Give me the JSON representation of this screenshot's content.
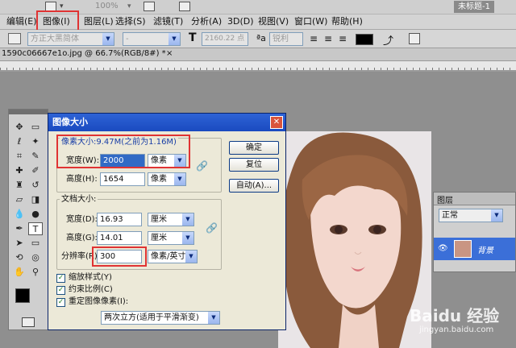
{
  "topbar": {
    "workspace_label": "未标题-1",
    "zoom": "100%"
  },
  "menubar": {
    "items": [
      "编辑(E)",
      "图像(I)",
      "图层(L)",
      "选择(S)",
      "滤镜(T)",
      "分析(A)",
      "3D(D)",
      "视图(V)",
      "窗口(W)",
      "帮助(H)"
    ]
  },
  "options": {
    "font_family": "方正大黑简体",
    "font_size": "2160.22 点",
    "anti_alias": "锐利"
  },
  "tab": {
    "title": "1590c06667e1o.jpg @ 66.7%(RGB/8#) *"
  },
  "dialog": {
    "title": "图像大小",
    "pixel_size_label": "像素大小:9.47M(之前为1.16M)",
    "width_label": "宽度(W):",
    "width_value": "2000",
    "width_unit": "像素",
    "height_label": "高度(H):",
    "height_value": "1654",
    "height_unit": "像素",
    "doc_size_label": "文档大小:",
    "doc_width_label": "宽度(D):",
    "doc_width_value": "16.93",
    "doc_width_unit": "厘米",
    "doc_height_label": "高度(G):",
    "doc_height_value": "14.01",
    "doc_height_unit": "厘米",
    "resolution_label": "分辨率(R):",
    "resolution_value": "300",
    "resolution_unit": "像素/英寸",
    "ok": "确定",
    "reset": "复位",
    "auto": "自动(A)...",
    "scale_styles": "缩放样式(Y)",
    "constrain": "约束比例(C)",
    "resample": "重定图像像素(I):",
    "resample_method": "两次立方(适用于平滑渐变)"
  },
  "layers": {
    "title": "图层",
    "blend_mode": "正常",
    "layer_name": "背景"
  },
  "watermark": {
    "brand": "Baidu 经验",
    "url": "jingyan.baidu.com"
  },
  "colors": {
    "accent": "#2e63d6",
    "highlight": "#e03333"
  }
}
